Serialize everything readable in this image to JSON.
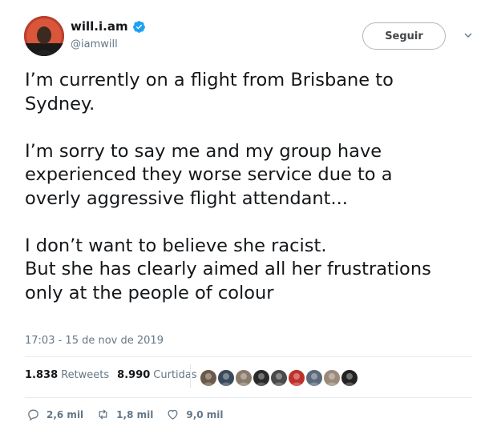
{
  "user": {
    "display_name": "will.i.am",
    "handle": "@iamwill",
    "verified": true
  },
  "follow_button": {
    "label": "Seguir"
  },
  "tweet": {
    "lines": [
      "I’m currently on a flight from Brisbane to",
      "Sydney.",
      "",
      "I’m sorry to say me and my group have",
      "experienced they worse service due to a",
      "overly aggressive flight attendant...",
      "",
      "I don’t want to believe she racist.",
      "But she has clearly aimed all her frustrations",
      "only at the people of colour"
    ],
    "timestamp": "17:03 - 15 de nov de 2019"
  },
  "stats": {
    "retweets_count": "1.838",
    "retweets_label": "Retweets",
    "likes_count": "8.990",
    "likes_label": "Curtidas"
  },
  "actions": {
    "reply_count": "2,6 mil",
    "retweet_count": "1,8 mil",
    "like_count": "9,0 mil"
  },
  "liker_avatars": [
    {
      "color": "#6b5a4a"
    },
    {
      "color": "#3a4a5a"
    },
    {
      "color": "#8a7a6a"
    },
    {
      "color": "#2a2a2a"
    },
    {
      "color": "#4a4a4a"
    },
    {
      "color": "#c0302a"
    },
    {
      "color": "#5a6a7a"
    },
    {
      "color": "#9a8a7a"
    },
    {
      "color": "#222222"
    }
  ],
  "colors": {
    "verified": "#1da1f2",
    "muted": "#657786",
    "text": "#14171a"
  }
}
